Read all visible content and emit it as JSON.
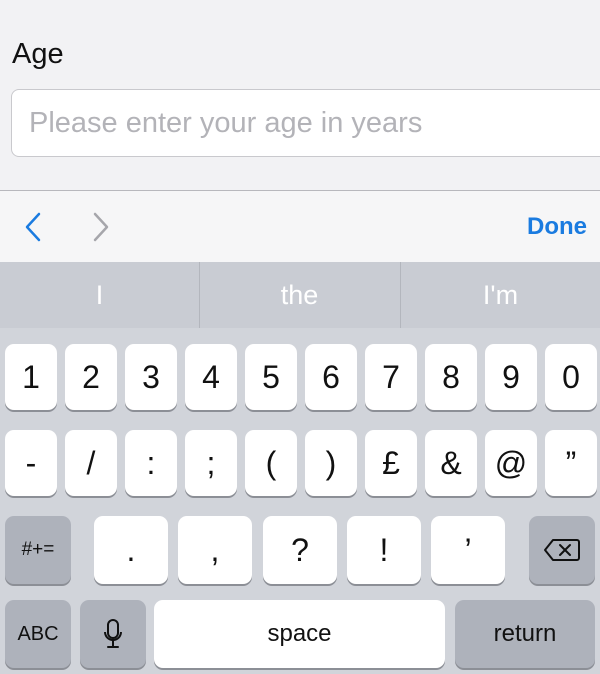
{
  "form": {
    "label": "Age",
    "placeholder": "Please enter your age in years",
    "value": ""
  },
  "toolbar": {
    "prev_icon": "chevron-left-icon",
    "next_icon": "chevron-right-icon",
    "done_label": "Done",
    "accent_color": "#1a7be0"
  },
  "keyboard": {
    "suggestions": [
      "I",
      "the",
      "I'm"
    ],
    "row1": [
      "1",
      "2",
      "3",
      "4",
      "5",
      "6",
      "7",
      "8",
      "9",
      "0"
    ],
    "row2": [
      "-",
      "/",
      ":",
      ";",
      "(",
      ")",
      "£",
      "&",
      "@",
      "”"
    ],
    "row3": {
      "symbols_label": "#+=",
      "keys": [
        ".",
        ",",
        "?",
        "!",
        "’"
      ],
      "delete_icon": "backspace-icon"
    },
    "row4": {
      "abc_label": "ABC",
      "mic_icon": "microphone-icon",
      "space_label": "space",
      "return_label": "return"
    }
  }
}
